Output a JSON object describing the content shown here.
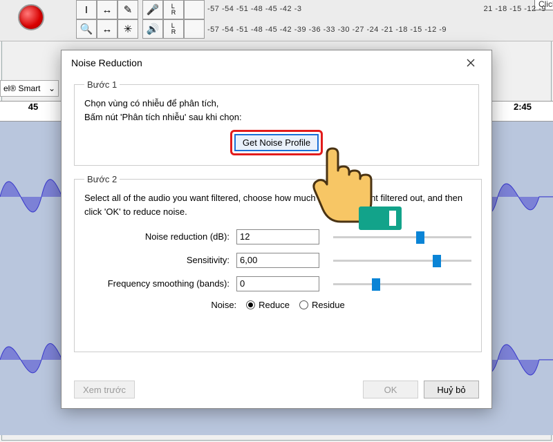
{
  "toolbar": {
    "meter_tooltip": "Click to Start Monitoring",
    "meter_numbers_top": "-57 -54 -51 -48 -45 -42 -3",
    "meter_numbers_top_right": "21 -18 -15 -12 -9",
    "meter_numbers_bottom": "-57 -54 -51 -48 -45 -42 -39 -36 -33 -30 -27 -24 -21 -18 -15 -12 -9",
    "smart_label": "el® Smart",
    "ruler_label_left": "45",
    "ruler_label_right": "2:45"
  },
  "dialog": {
    "title": "Noise Reduction",
    "step1_legend": "Bước 1",
    "step1_line1": "Chọn vùng có nhiễu để phân tích,",
    "step1_line2": "Bấm nút 'Phân tích nhiễu' sau khi chọn:",
    "get_noise_profile": "Get Noise Profile",
    "step2_legend": "Bước 2",
    "step2_text": "Select all of the audio you want filtered, choose how much noise you want filtered out, and then click 'OK' to reduce noise.",
    "noise_reduction_label": "Noise reduction (dB):",
    "noise_reduction_value": "12",
    "sensitivity_label": "Sensitivity:",
    "sensitivity_value": "6,00",
    "freq_smoothing_label": "Frequency smoothing (bands):",
    "freq_smoothing_value": "0",
    "noise_label": "Noise:",
    "noise_reduce": "Reduce",
    "noise_residue": "Residue",
    "preview": "Xem trước",
    "ok": "OK",
    "cancel": "Huỷ bỏ"
  }
}
